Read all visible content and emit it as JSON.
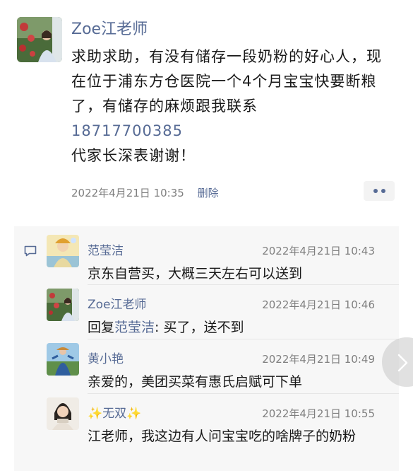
{
  "post": {
    "author": "Zoe江老师",
    "text": "求助求助，有没有储存一段奶粉的好心人，现在位于浦东方仓医院一个4个月宝宝快要断粮了，有储存的麻烦跟我联系",
    "phone": "18717700385",
    "text_after": "代家长深表谢谢！",
    "time": "2022年4月21日 10:35",
    "delete_label": "删除"
  },
  "comments": [
    {
      "name": "范莹洁",
      "time": "2022年4月21日 10:43",
      "text": "京东自营买，大概三天左右可以送到"
    },
    {
      "name": "Zoe江老师",
      "time": "2022年4月21日 10:46",
      "reply_prefix": "回复",
      "reply_to": "范莹洁",
      "text": ": 买了，送不到"
    },
    {
      "name": "黄小艳",
      "time": "2022年4月21日 10:49",
      "text": "亲爱的，美团买菜有惠氏启赋可下单"
    },
    {
      "name": "✨无双✨",
      "time": "2022年4月21日 10:55",
      "text": "江老师，我这边有人问宝宝吃的啥牌子的奶粉"
    }
  ],
  "colors": {
    "link": "#576b95",
    "text": "#191919",
    "meta": "#7f7f7f",
    "comment_bg": "#f7f7f7"
  },
  "icons": {
    "comment": "comment-bubble-icon",
    "more": "more-dots-icon",
    "next": "chevron-right-icon"
  }
}
